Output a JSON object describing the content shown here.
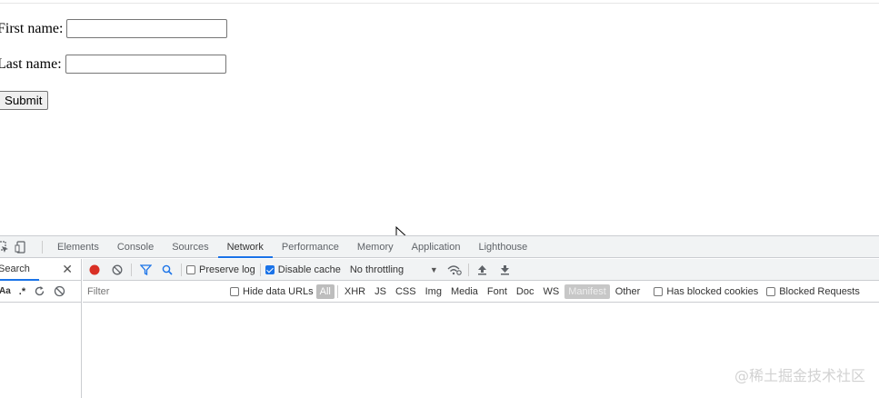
{
  "form": {
    "first_name_label": "First name:",
    "first_name_value": "",
    "last_name_label": "Last name:",
    "last_name_value": "",
    "submit_label": "Submit"
  },
  "devtools": {
    "tabs": [
      "Elements",
      "Console",
      "Sources",
      "Network",
      "Performance",
      "Memory",
      "Application",
      "Lighthouse"
    ],
    "active_tab": "Network",
    "search_label": "Search",
    "search_case_label": "Aa",
    "search_regex_label": ".*",
    "preserve_log_label": "Preserve log",
    "preserve_log_checked": false,
    "disable_cache_label": "Disable cache",
    "disable_cache_checked": true,
    "throttling_value": "No throttling",
    "filter_placeholder": "Filter",
    "hide_data_urls_label": "Hide data URLs",
    "filter_types": [
      "All",
      "XHR",
      "JS",
      "CSS",
      "Img",
      "Media",
      "Font",
      "Doc",
      "WS",
      "Manifest",
      "Other"
    ],
    "has_blocked_cookies_label": "Has blocked cookies",
    "blocked_requests_label": "Blocked Requests",
    "colors": {
      "accent": "#1a73e8",
      "record": "#d93025"
    }
  },
  "watermark": "@稀土掘金技术社区"
}
